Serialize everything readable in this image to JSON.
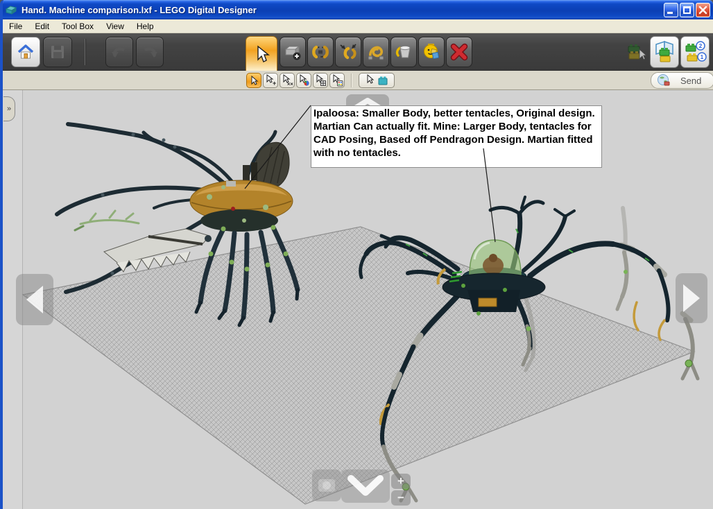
{
  "window": {
    "title": "Hand. Machine comparison.lxf - LEGO Digital Designer"
  },
  "menu": {
    "items": [
      {
        "label": "File"
      },
      {
        "label": "Edit"
      },
      {
        "label": "Tool Box"
      },
      {
        "label": "View"
      },
      {
        "label": "Help"
      }
    ]
  },
  "toolbar": {
    "main_tools": [
      {
        "name": "select",
        "state": "active"
      },
      {
        "name": "clone",
        "state": "normal"
      },
      {
        "name": "hinge",
        "state": "normal"
      },
      {
        "name": "hinge-align",
        "state": "normal"
      },
      {
        "name": "flex",
        "state": "normal"
      },
      {
        "name": "paint",
        "state": "normal"
      },
      {
        "name": "hide",
        "state": "normal"
      },
      {
        "name": "delete",
        "state": "normal"
      }
    ],
    "left_tools": [
      "home",
      "save-disabled",
      "undo-disabled",
      "redo-disabled"
    ],
    "right_tools": [
      "templates-dimmed",
      "view-mode",
      "building-guide"
    ],
    "guide_badge_top": "2",
    "guide_badge_bottom": "1"
  },
  "subtoolbar": {
    "tools": [
      "select-single",
      "select-add",
      "select-multi",
      "select-color",
      "select-shape",
      "select-color-shape",
      "select-same"
    ],
    "badge_add": "+",
    "badge_multi": "××"
  },
  "send_button": {
    "label": "Send"
  },
  "expander": {
    "glyph": "»"
  },
  "camera_controls": {
    "zoom_in": "+",
    "zoom_out": "−"
  },
  "annotation": {
    "line1": "Ipaloosa: Smaller Body, better tentacles, Original design. Martian Can actually fit.",
    "line2": "Mine: Larger Body, tentacles for CAD Posing, Based off Pendragon Design. Martian fitted with no tentacles."
  },
  "icons": {
    "app": "teal-lego-brick",
    "home": "house",
    "save": "floppy-disk",
    "undo": "curved-arrow-left",
    "redo": "curved-arrow-right",
    "select": "cursor-arrow",
    "clone": "brick-plus",
    "hinge": "yellow-joint-rotate",
    "hinge_align": "yellow-joint-arrows",
    "flex": "looped-tube",
    "paint": "paint-bucket",
    "hide": "minifig-head",
    "delete": "red-x",
    "send": "globe-brick"
  },
  "colors": {
    "titlebar_blue": "#0b3fb4",
    "accent_orange": "#f2a220",
    "toolbar_dark": "#434343",
    "strip_beige": "#dbd8cb",
    "viewport_bg": "#d2d2d2",
    "grid_line": "#8f8f8f",
    "annotation_bg": "#ffffff",
    "delete_red": "#c1272d",
    "model_left_body_tan": "#b3832a",
    "model_right_body_navy": "#16262e",
    "dome_trans_green": "#96c378",
    "joint_green": "#79b356"
  }
}
